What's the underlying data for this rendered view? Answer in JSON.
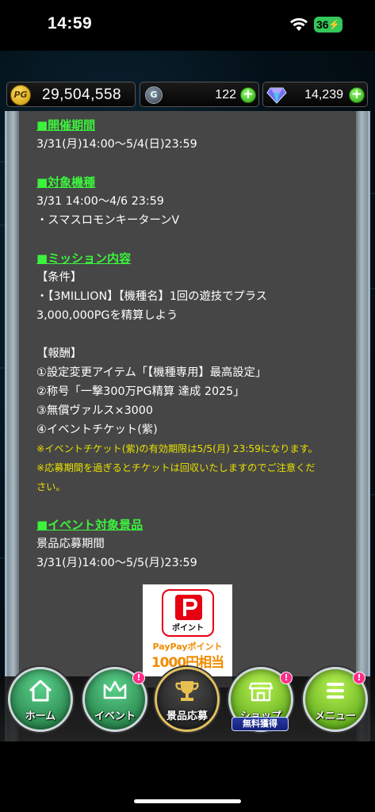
{
  "status_bar": {
    "time": "14:59",
    "battery": "36",
    "wifi_icon": "wifi-icon",
    "charging_icon": "bolt-icon",
    "battery_color": "#34c759"
  },
  "currency_bar": {
    "pg": {
      "icon_text": "PG",
      "value": "29,504,558"
    },
    "g": {
      "icon_text": "G",
      "value": "122"
    },
    "diamond": {
      "icon": "gem-icon",
      "value": "14,239"
    },
    "plus_icon": "plus-icon"
  },
  "content": {
    "period_heading": "■開催期間",
    "period_text": "3/31(月)14:00〜5/4(日)23:59",
    "machine_heading": "■対象機種",
    "machine_period": "3/31 14:00〜4/6 23:59",
    "machine_name": "・スマスロモンキーターンV",
    "mission_heading": "■ミッション内容",
    "conditions_label": "【条件】",
    "conditions_line1": "・【3MILLION】【機種名】1回の遊技でプラス",
    "conditions_line2": "3,000,000PGを精算しよう",
    "reward_label": "【報酬】",
    "reward_1": "①設定変更アイテム「【機種専用】最高設定」",
    "reward_2": "②称号「一撃300万PG精算 達成 2025」",
    "reward_3": "③無償ヴァルス×3000",
    "reward_4": "④イベントチケット(紫)",
    "note_1": "※イベントチケット(紫)の有効期限は5/5(月) 23:59になります。",
    "note_2a": "※応募期間を過ぎるとチケットは回収いたしますのでご注意くだ",
    "note_2b": "さい。",
    "prize_heading": "■イベント対象景品",
    "prize_period_label": "景品応募期間",
    "prize_period_text": "3/31(月)14:00〜5/5(月)23:59",
    "paypay": {
      "logo_text": "ポイント",
      "line1": "PayPayポイント",
      "line2": "1000円相当",
      "brand_color": "#e60012"
    }
  },
  "nav": {
    "home": {
      "label": "ホーム",
      "icon": "house-icon"
    },
    "event": {
      "label": "イベント",
      "icon": "crown-icon",
      "badge": "!"
    },
    "prize": {
      "label": "景品応募",
      "icon": "trophy-icon"
    },
    "shop": {
      "label": "ショップ",
      "icon": "shop-icon",
      "badge": "!",
      "tag": "無料獲得"
    },
    "menu": {
      "label": "メニュー",
      "icon": "menu-icon",
      "badge": "!"
    }
  }
}
